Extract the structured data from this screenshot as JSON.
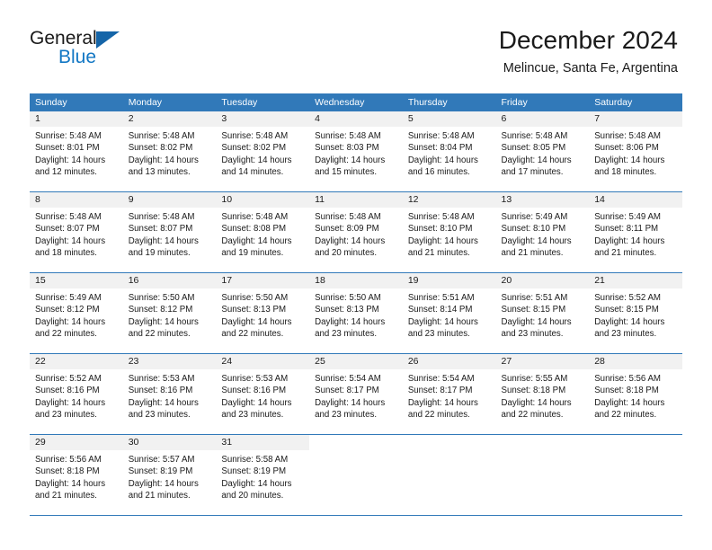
{
  "brand": {
    "name_top": "General",
    "name_bottom": "Blue",
    "triangle_icon": "blue-triangle-icon",
    "accent_color": "#1277c4",
    "triangle_color": "#1565a8"
  },
  "header": {
    "title": "December 2024",
    "subtitle": "Melincue, Santa Fe, Argentina"
  },
  "colors": {
    "header_band": "#3179b9",
    "day_number_band": "#f1f1f1",
    "row_separator": "#3179b9",
    "text": "#1a1a1a",
    "header_text": "#ffffff"
  },
  "weekday_headers": [
    "Sunday",
    "Monday",
    "Tuesday",
    "Wednesday",
    "Thursday",
    "Friday",
    "Saturday"
  ],
  "weeks": [
    [
      {
        "day": "1",
        "sunrise": "Sunrise: 5:48 AM",
        "sunset": "Sunset: 8:01 PM",
        "daylight_line1": "Daylight: 14 hours",
        "daylight_line2": "and 12 minutes."
      },
      {
        "day": "2",
        "sunrise": "Sunrise: 5:48 AM",
        "sunset": "Sunset: 8:02 PM",
        "daylight_line1": "Daylight: 14 hours",
        "daylight_line2": "and 13 minutes."
      },
      {
        "day": "3",
        "sunrise": "Sunrise: 5:48 AM",
        "sunset": "Sunset: 8:02 PM",
        "daylight_line1": "Daylight: 14 hours",
        "daylight_line2": "and 14 minutes."
      },
      {
        "day": "4",
        "sunrise": "Sunrise: 5:48 AM",
        "sunset": "Sunset: 8:03 PM",
        "daylight_line1": "Daylight: 14 hours",
        "daylight_line2": "and 15 minutes."
      },
      {
        "day": "5",
        "sunrise": "Sunrise: 5:48 AM",
        "sunset": "Sunset: 8:04 PM",
        "daylight_line1": "Daylight: 14 hours",
        "daylight_line2": "and 16 minutes."
      },
      {
        "day": "6",
        "sunrise": "Sunrise: 5:48 AM",
        "sunset": "Sunset: 8:05 PM",
        "daylight_line1": "Daylight: 14 hours",
        "daylight_line2": "and 17 minutes."
      },
      {
        "day": "7",
        "sunrise": "Sunrise: 5:48 AM",
        "sunset": "Sunset: 8:06 PM",
        "daylight_line1": "Daylight: 14 hours",
        "daylight_line2": "and 18 minutes."
      }
    ],
    [
      {
        "day": "8",
        "sunrise": "Sunrise: 5:48 AM",
        "sunset": "Sunset: 8:07 PM",
        "daylight_line1": "Daylight: 14 hours",
        "daylight_line2": "and 18 minutes."
      },
      {
        "day": "9",
        "sunrise": "Sunrise: 5:48 AM",
        "sunset": "Sunset: 8:07 PM",
        "daylight_line1": "Daylight: 14 hours",
        "daylight_line2": "and 19 minutes."
      },
      {
        "day": "10",
        "sunrise": "Sunrise: 5:48 AM",
        "sunset": "Sunset: 8:08 PM",
        "daylight_line1": "Daylight: 14 hours",
        "daylight_line2": "and 19 minutes."
      },
      {
        "day": "11",
        "sunrise": "Sunrise: 5:48 AM",
        "sunset": "Sunset: 8:09 PM",
        "daylight_line1": "Daylight: 14 hours",
        "daylight_line2": "and 20 minutes."
      },
      {
        "day": "12",
        "sunrise": "Sunrise: 5:48 AM",
        "sunset": "Sunset: 8:10 PM",
        "daylight_line1": "Daylight: 14 hours",
        "daylight_line2": "and 21 minutes."
      },
      {
        "day": "13",
        "sunrise": "Sunrise: 5:49 AM",
        "sunset": "Sunset: 8:10 PM",
        "daylight_line1": "Daylight: 14 hours",
        "daylight_line2": "and 21 minutes."
      },
      {
        "day": "14",
        "sunrise": "Sunrise: 5:49 AM",
        "sunset": "Sunset: 8:11 PM",
        "daylight_line1": "Daylight: 14 hours",
        "daylight_line2": "and 21 minutes."
      }
    ],
    [
      {
        "day": "15",
        "sunrise": "Sunrise: 5:49 AM",
        "sunset": "Sunset: 8:12 PM",
        "daylight_line1": "Daylight: 14 hours",
        "daylight_line2": "and 22 minutes."
      },
      {
        "day": "16",
        "sunrise": "Sunrise: 5:50 AM",
        "sunset": "Sunset: 8:12 PM",
        "daylight_line1": "Daylight: 14 hours",
        "daylight_line2": "and 22 minutes."
      },
      {
        "day": "17",
        "sunrise": "Sunrise: 5:50 AM",
        "sunset": "Sunset: 8:13 PM",
        "daylight_line1": "Daylight: 14 hours",
        "daylight_line2": "and 22 minutes."
      },
      {
        "day": "18",
        "sunrise": "Sunrise: 5:50 AM",
        "sunset": "Sunset: 8:13 PM",
        "daylight_line1": "Daylight: 14 hours",
        "daylight_line2": "and 23 minutes."
      },
      {
        "day": "19",
        "sunrise": "Sunrise: 5:51 AM",
        "sunset": "Sunset: 8:14 PM",
        "daylight_line1": "Daylight: 14 hours",
        "daylight_line2": "and 23 minutes."
      },
      {
        "day": "20",
        "sunrise": "Sunrise: 5:51 AM",
        "sunset": "Sunset: 8:15 PM",
        "daylight_line1": "Daylight: 14 hours",
        "daylight_line2": "and 23 minutes."
      },
      {
        "day": "21",
        "sunrise": "Sunrise: 5:52 AM",
        "sunset": "Sunset: 8:15 PM",
        "daylight_line1": "Daylight: 14 hours",
        "daylight_line2": "and 23 minutes."
      }
    ],
    [
      {
        "day": "22",
        "sunrise": "Sunrise: 5:52 AM",
        "sunset": "Sunset: 8:16 PM",
        "daylight_line1": "Daylight: 14 hours",
        "daylight_line2": "and 23 minutes."
      },
      {
        "day": "23",
        "sunrise": "Sunrise: 5:53 AM",
        "sunset": "Sunset: 8:16 PM",
        "daylight_line1": "Daylight: 14 hours",
        "daylight_line2": "and 23 minutes."
      },
      {
        "day": "24",
        "sunrise": "Sunrise: 5:53 AM",
        "sunset": "Sunset: 8:16 PM",
        "daylight_line1": "Daylight: 14 hours",
        "daylight_line2": "and 23 minutes."
      },
      {
        "day": "25",
        "sunrise": "Sunrise: 5:54 AM",
        "sunset": "Sunset: 8:17 PM",
        "daylight_line1": "Daylight: 14 hours",
        "daylight_line2": "and 23 minutes."
      },
      {
        "day": "26",
        "sunrise": "Sunrise: 5:54 AM",
        "sunset": "Sunset: 8:17 PM",
        "daylight_line1": "Daylight: 14 hours",
        "daylight_line2": "and 22 minutes."
      },
      {
        "day": "27",
        "sunrise": "Sunrise: 5:55 AM",
        "sunset": "Sunset: 8:18 PM",
        "daylight_line1": "Daylight: 14 hours",
        "daylight_line2": "and 22 minutes."
      },
      {
        "day": "28",
        "sunrise": "Sunrise: 5:56 AM",
        "sunset": "Sunset: 8:18 PM",
        "daylight_line1": "Daylight: 14 hours",
        "daylight_line2": "and 22 minutes."
      }
    ],
    [
      {
        "day": "29",
        "sunrise": "Sunrise: 5:56 AM",
        "sunset": "Sunset: 8:18 PM",
        "daylight_line1": "Daylight: 14 hours",
        "daylight_line2": "and 21 minutes."
      },
      {
        "day": "30",
        "sunrise": "Sunrise: 5:57 AM",
        "sunset": "Sunset: 8:19 PM",
        "daylight_line1": "Daylight: 14 hours",
        "daylight_line2": "and 21 minutes."
      },
      {
        "day": "31",
        "sunrise": "Sunrise: 5:58 AM",
        "sunset": "Sunset: 8:19 PM",
        "daylight_line1": "Daylight: 14 hours",
        "daylight_line2": "and 20 minutes."
      },
      {
        "day": "",
        "sunrise": "",
        "sunset": "",
        "daylight_line1": "",
        "daylight_line2": ""
      },
      {
        "day": "",
        "sunrise": "",
        "sunset": "",
        "daylight_line1": "",
        "daylight_line2": ""
      },
      {
        "day": "",
        "sunrise": "",
        "sunset": "",
        "daylight_line1": "",
        "daylight_line2": ""
      },
      {
        "day": "",
        "sunrise": "",
        "sunset": "",
        "daylight_line1": "",
        "daylight_line2": ""
      }
    ]
  ]
}
